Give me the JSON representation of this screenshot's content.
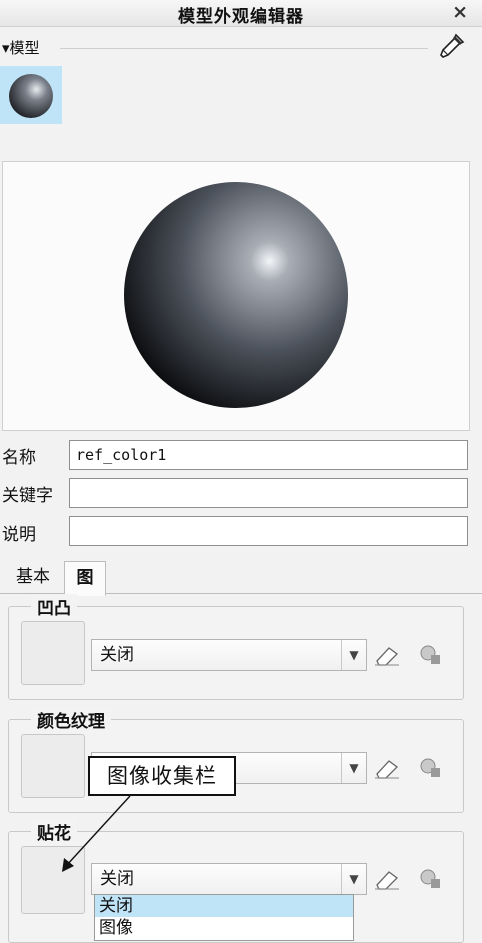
{
  "window": {
    "title": "模型外观编辑器",
    "close_glyph": "×"
  },
  "section": {
    "toggle_glyph": "▾",
    "label": "模型"
  },
  "fields": [
    {
      "label": "名称",
      "value": "ref_color1"
    },
    {
      "label": "关键字",
      "value": ""
    },
    {
      "label": "说明",
      "value": ""
    }
  ],
  "tabs": [
    {
      "label": "基本",
      "active": false
    },
    {
      "label": "图",
      "active": true
    }
  ],
  "groups": [
    {
      "title": "凹凸",
      "select_value": "关闭"
    },
    {
      "title": "颜色纹理",
      "select_value": ""
    },
    {
      "title": "贴花",
      "select_value": "关闭"
    }
  ],
  "dropdown": {
    "arrow_glyph": "▼",
    "options": [
      "关闭",
      "图像"
    ],
    "highlighted": "关闭"
  },
  "callout": {
    "text": "图像收集栏"
  },
  "icons": {
    "dropper": "eyedropper-icon",
    "eraser": "eraser-icon",
    "bulb": "light-bulb-icon"
  },
  "colors": {
    "accent": "#bfe4f7",
    "sphere": "#4a4f58"
  }
}
